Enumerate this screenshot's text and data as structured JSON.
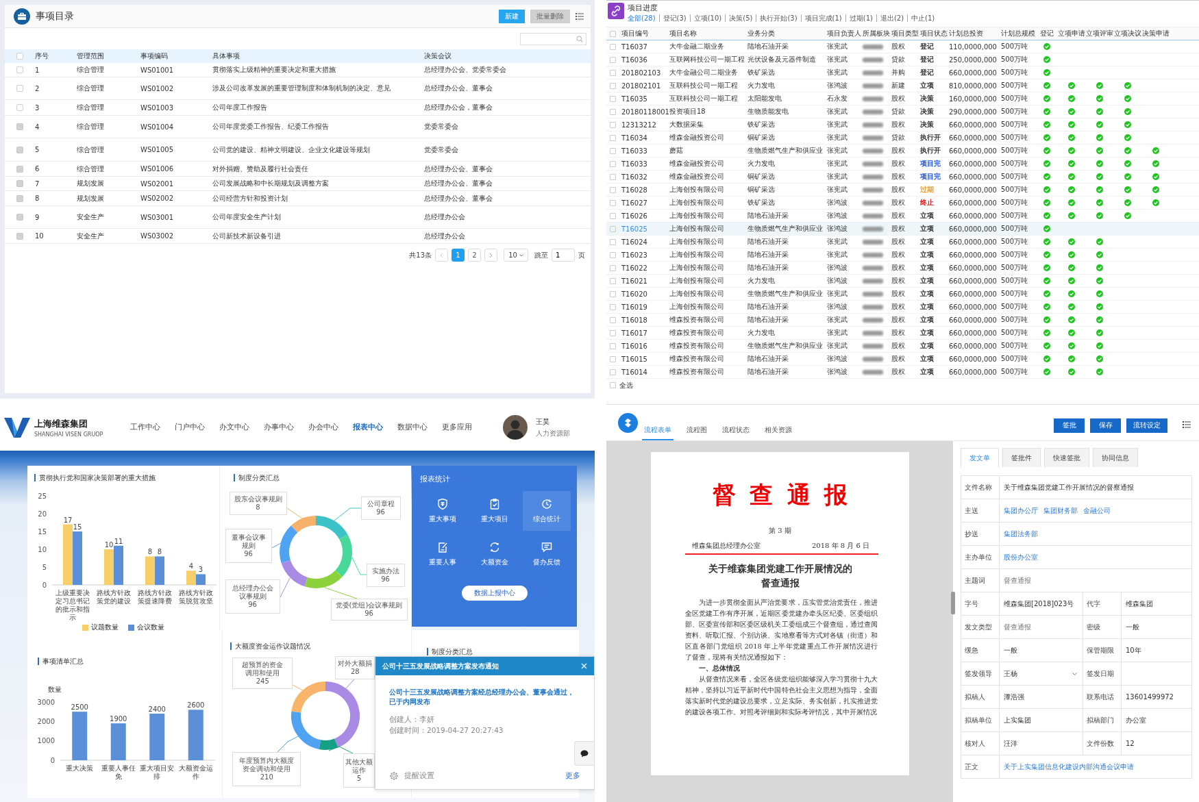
{
  "matters": {
    "title": "事项目录",
    "all_selected": false,
    "buttons": [
      {
        "label": "新建",
        "disabled": false
      },
      {
        "label": "批量删除",
        "disabled": true
      }
    ],
    "columns": [
      "序号",
      "管理范围",
      "事项编码",
      "具体事项",
      "决策会议"
    ],
    "rows": [
      {
        "no": "1",
        "scope": "综合管理",
        "code": "WS01001",
        "item": "贯彻落实上级精神的重要决定和重大措施",
        "meeting": "总经理办公会、党委常委会",
        "disabled": false
      },
      {
        "no": "2",
        "scope": "综合管理",
        "code": "WS01002",
        "item": "涉及公司改革发展的重要管理制度和体制机制的决定、意见",
        "meeting": "总经理办公会、董事会",
        "disabled": false
      },
      {
        "no": "3",
        "scope": "综合管理",
        "code": "WS01003",
        "item": "公司年度工作报告",
        "meeting": "总经理办公会，董事会",
        "disabled": false
      },
      {
        "no": "4",
        "scope": "综合管理",
        "code": "WS01004",
        "item": "公司年度党委工作报告、纪委工作报告",
        "meeting": "党委常委会",
        "disabled": true
      },
      {
        "no": "5",
        "scope": "综合管理",
        "code": "WS01005",
        "item": "公司党的建设、精神文明建设、企业文化建设等规划",
        "meeting": "党委常委会",
        "disabled": true
      },
      {
        "no": "6",
        "scope": "综合管理",
        "code": "WS01006",
        "item": "对外捐赠、赞助及履行社会责任",
        "meeting": "总经理办公会、董事会",
        "disabled": true
      },
      {
        "no": "7",
        "scope": "规划发展",
        "code": "WS02001",
        "item": "公司发展战略和中长期规划及调整方案",
        "meeting": "总经理办公会、董事会",
        "disabled": true
      },
      {
        "no": "8",
        "scope": "规划发展",
        "code": "WS02002",
        "item": "公司经营方针和投资计划",
        "meeting": "总经理办公会、董事会",
        "disabled": true
      },
      {
        "no": "9",
        "scope": "安全生产",
        "code": "WS03001",
        "item": "公司年度安全生产计划",
        "meeting": "总经理办公会",
        "disabled": true
      },
      {
        "no": "10",
        "scope": "安全生产",
        "code": "WS03002",
        "item": "公司新技术新设备引进",
        "meeting": "总经理办公会",
        "disabled": true
      }
    ],
    "pagination": {
      "total": "共13条",
      "pages": [
        {
          "label": "1",
          "selected": true
        },
        {
          "label": "2",
          "selected": false
        }
      ],
      "page_size": "10",
      "jump_label": "跳至",
      "jump_value": "1",
      "unit": "页"
    }
  },
  "progress": {
    "title": "项目进度",
    "all_selected": false,
    "filters": [
      {
        "label": "全部(28)",
        "selected": true
      },
      {
        "label": "登记(3)",
        "selected": false
      },
      {
        "label": "立项(10)",
        "selected": false
      },
      {
        "label": "决策(5)",
        "selected": false
      },
      {
        "label": "执行开始(3)",
        "selected": false
      },
      {
        "label": "项目完成(1)",
        "selected": false
      },
      {
        "label": "过期(1)",
        "selected": false
      },
      {
        "label": "退出(2)",
        "selected": false
      },
      {
        "label": "中止(1)",
        "selected": false
      }
    ],
    "columns": [
      "项目编号",
      "项目名称",
      "业务分类",
      "项目负责人",
      "所属板块",
      "项目类型",
      "项目状态",
      "计划总投资",
      "计划总规模",
      "登记",
      "立项申请",
      "立项评审",
      "立项决议",
      "决策申请"
    ],
    "rows": [
      {
        "code": "T16037",
        "name": "大牛金融二期业务",
        "category": "陆地石油开采",
        "manager": "张宪武",
        "type": "股权",
        "status": "登记",
        "color": "#333333",
        "invest": "110,0000,000",
        "scale": "500万吨",
        "steps": [
          true,
          false,
          false,
          false,
          false
        ],
        "selected": false
      },
      {
        "code": "T16036",
        "name": "互联网科技公司一期工程",
        "category": "光伏设备及元器件制造",
        "manager": "张宪武",
        "type": "贷款",
        "status": "登记",
        "color": "#333333",
        "invest": "250,0000,000",
        "scale": "500万吨",
        "steps": [
          true,
          false,
          false,
          false,
          false
        ],
        "selected": false
      },
      {
        "code": "201802103",
        "name": "大牛金融公司二期业务",
        "category": "铁矿采选",
        "manager": "张宪武",
        "type": "并购",
        "status": "登记",
        "color": "#333333",
        "invest": "660,0000,000",
        "scale": "500万吨",
        "steps": [
          true,
          false,
          false,
          false,
          false
        ],
        "selected": false
      },
      {
        "code": "201802101",
        "name": "互联科技公司一期工程",
        "category": "火力发电",
        "manager": "张鸿波",
        "type": "新建",
        "status": "立项",
        "color": "#333333",
        "invest": "810,0000,000",
        "scale": "500万吨",
        "steps": [
          true,
          true,
          true,
          true,
          false
        ],
        "selected": false
      },
      {
        "code": "T16035",
        "name": "互联科技公司一期工程",
        "category": "太阳能发电",
        "manager": "石永发",
        "type": "股权",
        "status": "决策",
        "color": "#333333",
        "invest": "160,0000,000",
        "scale": "500万吨",
        "steps": [
          true,
          true,
          true,
          true,
          false
        ],
        "selected": false
      },
      {
        "code": "20180118001",
        "name": "投资项目18",
        "category": "生物质能发电",
        "manager": "张宪武",
        "type": "贷款",
        "status": "决策",
        "color": "#333333",
        "invest": "290,0000,000",
        "scale": "500万吨",
        "steps": [
          true,
          true,
          true,
          true,
          false
        ],
        "selected": false
      },
      {
        "code": "12313212",
        "name": "大数据采集",
        "category": "铁矿采选",
        "manager": "张宪武",
        "type": "股权",
        "status": "决策",
        "color": "#333333",
        "invest": "660,0000,000",
        "scale": "500万吨",
        "steps": [
          true,
          true,
          true,
          true,
          false
        ],
        "selected": false
      },
      {
        "code": "T16034",
        "name": "维森金融投资公司",
        "category": "铜矿采选",
        "manager": "张宪武",
        "type": "贷款",
        "status": "执行开",
        "color": "#333333",
        "invest": "660,0000,000",
        "scale": "500万吨",
        "steps": [
          true,
          true,
          true,
          true,
          false
        ],
        "selected": false
      },
      {
        "code": "T16033",
        "name": "蘑菇",
        "category": "生物质燃气生产和供应业",
        "manager": "张宪武",
        "type": "股权",
        "status": "执行开",
        "color": "#333333",
        "invest": "660,0000,000",
        "scale": "500万吨",
        "steps": [
          true,
          true,
          true,
          true,
          true
        ],
        "selected": false
      },
      {
        "code": "T16033",
        "name": "维森金融投资公司",
        "category": "火力发电",
        "manager": "张宪武",
        "type": "股权",
        "status": "项目完",
        "color": "#2255dd",
        "invest": "660,0000,000",
        "scale": "500万吨",
        "steps": [
          true,
          true,
          true,
          true,
          true
        ],
        "selected": false
      },
      {
        "code": "T16032",
        "name": "维森金融投资公司",
        "category": "铜矿采选",
        "manager": "张宪武",
        "type": "股权",
        "status": "项目完",
        "color": "#2255dd",
        "invest": "660,0000,000",
        "scale": "500万吨",
        "steps": [
          true,
          true,
          true,
          true,
          true
        ],
        "selected": false
      },
      {
        "code": "T16028",
        "name": "上海创投有限公司",
        "category": "铜矿采选",
        "manager": "张宪武",
        "type": "股权",
        "status": "过期",
        "color": "#f59a23",
        "invest": "660,0000,000",
        "scale": "500万吨",
        "steps": [
          true,
          true,
          true,
          true,
          true
        ],
        "selected": false
      },
      {
        "code": "T16027",
        "name": "上海创投有限公司",
        "category": "铁矿采选",
        "manager": "张鸿波",
        "type": "股权",
        "status": "终止",
        "color": "#e02020",
        "invest": "660,0000,000",
        "scale": "500万吨",
        "steps": [
          true,
          true,
          true,
          true,
          true
        ],
        "selected": false
      },
      {
        "code": "T16026",
        "name": "上海创投有限公司",
        "category": "陆地石油开采",
        "manager": "张鸿波",
        "type": "股权",
        "status": "立项",
        "color": "#333333",
        "invest": "660,0000,000",
        "scale": "500万吨",
        "steps": [
          true,
          true,
          true,
          true,
          false
        ],
        "selected": false
      },
      {
        "code": "T16025",
        "name": "上海创投有限公司",
        "category": "生物质燃气生产和供应业",
        "manager": "张鸿波",
        "type": "股权",
        "status": "立项",
        "color": "#333333",
        "invest": "660,0000,000",
        "scale": "500万吨",
        "steps": [
          true,
          false,
          false,
          false,
          false
        ],
        "selected": true
      },
      {
        "code": "T16024",
        "name": "上海创投有限公司",
        "category": "陆地石油开采",
        "manager": "张宪武",
        "type": "股权",
        "status": "立项",
        "color": "#333333",
        "invest": "660,0000,000",
        "scale": "500万吨",
        "steps": [
          true,
          true,
          true,
          false,
          false
        ],
        "selected": false
      },
      {
        "code": "T16023",
        "name": "上海创投有限公司",
        "category": "陆地石油开采",
        "manager": "张宪武",
        "type": "股权",
        "status": "立项",
        "color": "#333333",
        "invest": "660,0000,000",
        "scale": "500万吨",
        "steps": [
          true,
          true,
          true,
          false,
          false
        ],
        "selected": false
      },
      {
        "code": "T16022",
        "name": "上海创投有限公司",
        "category": "陆地石油开采",
        "manager": "张鸿波",
        "type": "股权",
        "status": "立项",
        "color": "#333333",
        "invest": "660,0000,000",
        "scale": "500万吨",
        "steps": [
          true,
          true,
          true,
          false,
          false
        ],
        "selected": false
      },
      {
        "code": "T16021",
        "name": "上海创投有限公司",
        "category": "火力发电",
        "manager": "张鸿波",
        "type": "股权",
        "status": "立项",
        "color": "#333333",
        "invest": "660,0000,000",
        "scale": "500万吨",
        "steps": [
          true,
          true,
          true,
          false,
          false
        ],
        "selected": false
      },
      {
        "code": "T16020",
        "name": "上海创投有限公司",
        "category": "生物质燃气生产和供应业",
        "manager": "张宪武",
        "type": "股权",
        "status": "立项",
        "color": "#333333",
        "invest": "660,0000,000",
        "scale": "500万吨",
        "steps": [
          true,
          true,
          true,
          false,
          false
        ],
        "selected": false
      },
      {
        "code": "T16019",
        "name": "上海创投有限公司",
        "category": "陆地石油开采",
        "manager": "张鸿波",
        "type": "股权",
        "status": "立项",
        "color": "#333333",
        "invest": "660,0000,000",
        "scale": "500万吨",
        "steps": [
          true,
          true,
          true,
          false,
          false
        ],
        "selected": false
      },
      {
        "code": "T16018",
        "name": "维森投资有限公司",
        "category": "陆地石油开采",
        "manager": "张宪武",
        "type": "股权",
        "status": "立项",
        "color": "#333333",
        "invest": "660,0000,000",
        "scale": "500万吨",
        "steps": [
          true,
          true,
          true,
          false,
          false
        ],
        "selected": false
      },
      {
        "code": "T16017",
        "name": "维森投资有限公司",
        "category": "火力发电",
        "manager": "张宪武",
        "type": "股权",
        "status": "立项",
        "color": "#333333",
        "invest": "660,0000,000",
        "scale": "500万吨",
        "steps": [
          true,
          true,
          true,
          false,
          false
        ],
        "selected": false
      },
      {
        "code": "T16016",
        "name": "维森投资有限公司",
        "category": "生物质燃气生产和供应业",
        "manager": "张宪武",
        "type": "股权",
        "status": "立项",
        "color": "#333333",
        "invest": "660,0000,000",
        "scale": "500万吨",
        "steps": [
          true,
          true,
          true,
          false,
          false
        ],
        "selected": false
      },
      {
        "code": "T16015",
        "name": "维森投资有限公司",
        "category": "陆地石油开采",
        "manager": "张鸿波",
        "type": "股权",
        "status": "立项",
        "color": "#333333",
        "invest": "660,0000,000",
        "scale": "500万吨",
        "steps": [
          true,
          true,
          true,
          false,
          false
        ],
        "selected": false
      },
      {
        "code": "T16014",
        "name": "维森投资有限公司",
        "category": "陆地石油开采",
        "manager": "张鸿波",
        "type": "股权",
        "status": "立项",
        "color": "#333333",
        "invest": "660,0000,000",
        "scale": "500万吨",
        "steps": [
          true,
          true,
          true,
          false,
          false
        ],
        "selected": false
      }
    ],
    "footer": "全选"
  },
  "portal": {
    "brand": {
      "name": "上海维森集团",
      "subtitle": "SHANGHAI VISEN GRUOP"
    },
    "nav": [
      {
        "label": "工作中心",
        "selected": false
      },
      {
        "label": "门户中心",
        "selected": false
      },
      {
        "label": "办文中心",
        "selected": false
      },
      {
        "label": "办事中心",
        "selected": false
      },
      {
        "label": "办会中心",
        "selected": false
      },
      {
        "label": "报表中心",
        "selected": true
      },
      {
        "label": "数据中心",
        "selected": false
      },
      {
        "label": "更多应用",
        "selected": false
      }
    ],
    "user": {
      "name": "王昊",
      "dept": "人力资源部"
    },
    "measures": {
      "title": "贯彻执行党和国家决策部署的重大措施",
      "chart_data": {
        "type": "bar",
        "categories": [
          "上级重要决定习总书记的批示和指示",
          "路线方针政策党的建设",
          "路线方针政策提速降费",
          "路线方针政策脱贫攻坚"
        ],
        "series": [
          {
            "name": "议题数量",
            "color": "#f6cf6b",
            "values": [
              17,
              10,
              8,
              4
            ]
          },
          {
            "name": "会议数量",
            "color": "#5b8fd8",
            "values": [
              15,
              11,
              8,
              3
            ]
          }
        ],
        "ylim": [
          0,
          25
        ],
        "yticks": [
          0,
          5,
          10,
          15,
          20,
          25
        ],
        "data_labels": true,
        "legend": "bottom"
      }
    },
    "rules": {
      "title": "制度分类汇总",
      "callouts": [
        {
          "lines": [
            "股东会议事规则"
          ],
          "value": "8"
        },
        {
          "lines": [
            "公司章程"
          ],
          "value": "96"
        },
        {
          "lines": [
            "董事会议事",
            "规则"
          ],
          "value": "96"
        },
        {
          "lines": [
            "实施办法"
          ],
          "value": "96"
        },
        {
          "lines": [
            "总经理办公会",
            "议事规则"
          ],
          "value": "96"
        },
        {
          "lines": [
            "党委(党组)会议事规则"
          ],
          "value": "96"
        }
      ]
    },
    "report": {
      "title": "报表统计",
      "tiles": [
        {
          "label": "重大事项",
          "selected": false
        },
        {
          "label": "重大项目",
          "selected": false
        },
        {
          "label": "综合统计",
          "selected": true
        },
        {
          "label": "重要人事",
          "selected": false
        },
        {
          "label": "大额资金",
          "selected": false
        },
        {
          "label": "督办反馈",
          "selected": false
        }
      ],
      "button": "数据上报中心"
    },
    "items": {
      "title": "事项清单汇总",
      "chart_data": {
        "type": "bar",
        "ylabel": "数量",
        "categories": [
          "重大决策",
          "重要人事任免",
          "重大项目安排",
          "大额资金运作"
        ],
        "values": [
          2500,
          1900,
          2400,
          2600
        ],
        "ylim": [
          0,
          3000
        ],
        "yticks": [
          0,
          1000,
          2000,
          3000
        ],
        "data_labels": true
      }
    },
    "funds": {
      "title": "大额度资金运作议题情况",
      "callouts": [
        {
          "lines": [
            "超预算的资金",
            "调用和使用"
          ],
          "value": "245"
        },
        {
          "lines": [
            "对外大额捐"
          ],
          "value": "28"
        },
        {
          "lines": [
            "年度预算内大额度",
            "资金调动和使用"
          ],
          "value": "210"
        },
        {
          "lines": [
            "其他大额",
            "运作"
          ],
          "value": "5"
        }
      ]
    },
    "rules_2": {
      "title": "制度分类汇总"
    },
    "notification": {
      "title": "公司十三五发展战略调整方案发布通知",
      "message": "公司十三五发展战略调整方案经总经理办公会、董事会通过，已于内网发布",
      "creator": "创建人：李妍",
      "created": "创建时间：2019-04-27 20:27:43",
      "settings": "提醒设置",
      "more": "更多"
    }
  },
  "docflow": {
    "tabs": [
      {
        "label": "流程表单",
        "selected": true
      },
      {
        "label": "流程图",
        "selected": false
      },
      {
        "label": "流程状态",
        "selected": false
      },
      {
        "label": "相关资源",
        "selected": false
      }
    ],
    "buttons": [
      "签批",
      "保存",
      "流转设定"
    ],
    "document": {
      "heading": "督查通报",
      "issue": "第 3 期",
      "issuer": "维森集团总经理办公室",
      "date": "2018 年 8 月 6 日",
      "title": "关于维森集团党建工作开展情况的督查通报",
      "paragraphs": [
        {
          "kind": "body",
          "text": "为进一步贯彻全面从严治党要求，压实管党治党责任，推进全区党建工作有序开展，近期区委党建办牵头区纪委、区委组织部、区委宣传部和区委区级机关工委组成三个督查组，通过查阅资料、听取汇报、个别访谈、实地察看等方式对各镇（街道）和区直各部门党组织 2018 年上半年党建重点工作开展情况进行了督查，现将有关情况通报如下："
        },
        {
          "kind": "heading",
          "text": "一、总体情况"
        },
        {
          "kind": "body",
          "text": "从督查情况来看，全区各级党组织能够深入学习贯彻十九大精神，坚持以习近平新时代中国特色社会主义思想为指导，全面落实新时代党的建设总要求，立足实际、务实创新，扎实推进党的建设各项工作。对照考评细则和实际考评情况，其中开展情况"
        }
      ]
    },
    "form_tabs": [
      {
        "label": "发文单",
        "selected": true
      },
      {
        "label": "签批件",
        "selected": false
      },
      {
        "label": "快速签批",
        "selected": false
      },
      {
        "label": "协同信息",
        "selected": false
      }
    ],
    "form": [
      {
        "fields": [
          {
            "label": "文件名称",
            "kind": "text",
            "value": "关于维森集团党建工作开展情况的督察通报"
          }
        ]
      },
      {
        "fields": [
          {
            "label": "主送",
            "kind": "links",
            "links": [
              "集团办公厅",
              "集团财务部",
              "金融公司"
            ]
          }
        ]
      },
      {
        "fields": [
          {
            "label": "抄送",
            "kind": "links",
            "links": [
              "集团法务部"
            ]
          }
        ]
      },
      {
        "fields": [
          {
            "label": "主办单位",
            "kind": "links",
            "links": [
              "股份办公室"
            ]
          }
        ]
      },
      {
        "fields": [
          {
            "label": "主题词",
            "kind": "hint",
            "value": "督查通报"
          }
        ]
      },
      {
        "fields": [
          {
            "label": "字号",
            "kind": "text",
            "value": "维森集团[2018]023号"
          },
          {
            "label": "代字",
            "kind": "text",
            "value": "维森集团"
          }
        ]
      },
      {
        "fields": [
          {
            "label": "发文类型",
            "kind": "hint",
            "value": "督查通报"
          },
          {
            "label": "密级",
            "kind": "text",
            "value": "一般"
          }
        ]
      },
      {
        "fields": [
          {
            "label": "缓急",
            "kind": "text",
            "value": "一般"
          },
          {
            "label": "保管期限",
            "kind": "text",
            "value": "10年"
          }
        ]
      },
      {
        "fields": [
          {
            "label": "签发领导",
            "kind": "select",
            "value": "王杨"
          },
          {
            "label": "签发日期",
            "kind": "empty"
          }
        ]
      },
      {
        "fields": [
          {
            "label": "拟稿人",
            "kind": "text",
            "value": "潭浩强"
          },
          {
            "label": "联系电话",
            "kind": "text",
            "value": "13601499972"
          }
        ]
      },
      {
        "fields": [
          {
            "label": "拟稿单位",
            "kind": "text",
            "value": "上实集团"
          },
          {
            "label": "拟稿部门",
            "kind": "text",
            "value": "办公室"
          }
        ]
      },
      {
        "fields": [
          {
            "label": "核对人",
            "kind": "text",
            "value": "汪洋"
          },
          {
            "label": "文件份数",
            "kind": "text",
            "value": "12"
          }
        ]
      },
      {
        "fields": [
          {
            "label": "正文",
            "kind": "links",
            "links": [
              "关于上实集团信息化建设内部沟通会议申请"
            ]
          }
        ]
      }
    ]
  }
}
